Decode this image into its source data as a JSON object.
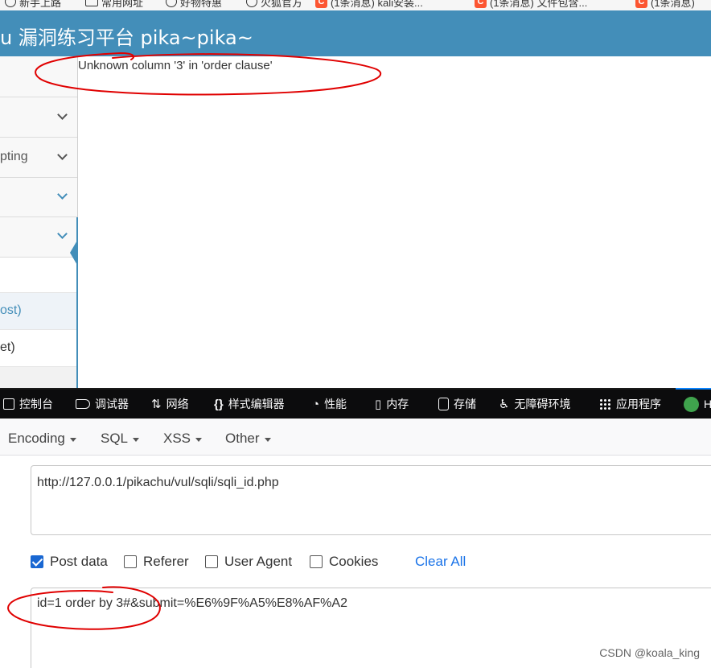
{
  "bookmarks": [
    {
      "label": "新手上路",
      "icon": "globe-icon"
    },
    {
      "label": "常用网址",
      "icon": "folder-icon"
    },
    {
      "label": "好物特惠",
      "icon": "globe-icon"
    },
    {
      "label": "火狐官方",
      "icon": "globe-icon"
    },
    {
      "label": "(1条消息) kali安装...",
      "icon": "csdn-icon"
    },
    {
      "label": "(1条消息) 文件包含...",
      "icon": "csdn-icon"
    },
    {
      "label": "(1条消息)",
      "icon": "csdn-icon"
    }
  ],
  "header": {
    "title": "u 漏洞练习平台 pika~pika~"
  },
  "sidebar": {
    "items": [
      {
        "label": "",
        "chevron": "chevron-down-icon"
      },
      {
        "label": "pting",
        "chevron": "chevron-down-icon"
      },
      {
        "label": "",
        "chevron": "chevron-down-icon"
      },
      {
        "label": "",
        "chevron": "chevron-down-icon"
      }
    ],
    "sub_items": [
      {
        "label": "ost)",
        "active": true
      },
      {
        "label": "et)",
        "active": false
      }
    ]
  },
  "main": {
    "error_message": "Unknown column '3' in 'order clause'"
  },
  "devtools": {
    "tabs": [
      {
        "label": "控制台",
        "icon": "console-icon"
      },
      {
        "label": "调试器",
        "icon": "debugger-icon"
      },
      {
        "label": "网络",
        "icon": "network-icon"
      },
      {
        "label": "样式编辑器",
        "icon": "braces-icon"
      },
      {
        "label": "性能",
        "icon": "gauge-icon"
      },
      {
        "label": "内存",
        "icon": "memory-icon"
      },
      {
        "label": "存储",
        "icon": "storage-icon"
      },
      {
        "label": "无障碍环境",
        "icon": "accessibility-icon"
      },
      {
        "label": "应用程序",
        "icon": "apps-grid-icon"
      },
      {
        "label": "H",
        "icon": "hackbar-icon"
      }
    ]
  },
  "hackbar": {
    "menus": [
      "Encoding",
      "SQL",
      "XSS",
      "Other"
    ],
    "url": "http://127.0.0.1/pikachu/vul/sqli/sqli_id.php",
    "options": [
      {
        "label": "Post data",
        "checked": true
      },
      {
        "label": "Referer",
        "checked": false
      },
      {
        "label": "User Agent",
        "checked": false
      },
      {
        "label": "Cookies",
        "checked": false
      }
    ],
    "clear_all": "Clear All",
    "post_data": "id=1 order by 3#&submit=%E6%9F%A5%E8%AF%A2"
  },
  "watermark": "CSDN @koala_king",
  "colors": {
    "header_bg": "#438eb9",
    "devtools_bg": "#0c0c0d",
    "link": "#1a73e8",
    "annotation": "#e00000"
  }
}
